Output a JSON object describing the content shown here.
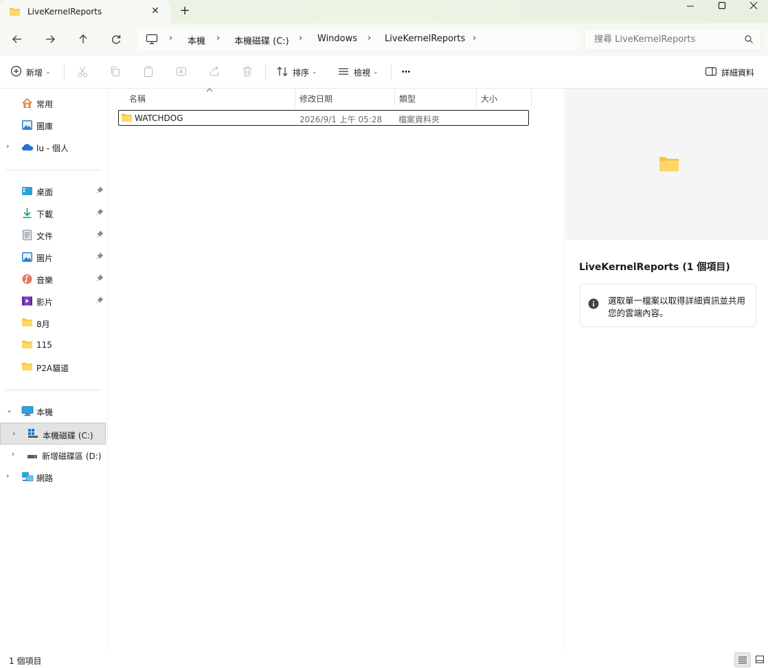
{
  "window": {
    "tab_title": "LiveKernelReports",
    "tab_close": "✕",
    "new_tab": "+"
  },
  "nav": {
    "breadcrumbs": [
      "本機",
      "本機磁碟 (C:)",
      "Windows",
      "LiveKernelReports"
    ],
    "search_placeholder": "搜尋 LiveKernelReports"
  },
  "toolbar": {
    "new_label": "新增",
    "sort_label": "排序",
    "view_label": "檢視",
    "more_label": "···",
    "details_label": "詳細資料"
  },
  "sidebar": {
    "quick": [
      {
        "label": "常用",
        "icon": "home-icon"
      },
      {
        "label": "圖庫",
        "icon": "gallery-icon"
      },
      {
        "label": "lu - 個人",
        "icon": "onedrive-icon"
      }
    ],
    "pinned": [
      {
        "label": "桌面",
        "icon": "desktop-icon"
      },
      {
        "label": "下載",
        "icon": "download-icon"
      },
      {
        "label": "文件",
        "icon": "document-icon"
      },
      {
        "label": "圖片",
        "icon": "pictures-icon"
      },
      {
        "label": "音樂",
        "icon": "music-icon"
      },
      {
        "label": "影片",
        "icon": "video-icon"
      }
    ],
    "folders": [
      {
        "label": "8月"
      },
      {
        "label": "115"
      },
      {
        "label": "P2A貓道"
      }
    ],
    "this_pc": "本機",
    "drives": [
      {
        "label": "本機磁碟 (C:)"
      },
      {
        "label": "新增磁碟區 (D:)"
      }
    ],
    "network": "網路"
  },
  "filelist": {
    "columns": [
      "名稱",
      "修改日期",
      "類型",
      "大小"
    ],
    "rows": [
      {
        "name": "WATCHDOG",
        "modified": "2026/9/1 上午 05:28",
        "type": "檔案資料夾",
        "size": ""
      }
    ]
  },
  "details": {
    "title": "LiveKernelReports (1 個項目)",
    "info": "選取單一檔案以取得詳細資訊並共用您的雲端內容。"
  },
  "status": {
    "item_count": "1 個項目"
  },
  "colors": {
    "folder": "#f5c342",
    "titlebar": "#eaf1e3",
    "selection_border": "#1a1a1a",
    "accent": "#0067c0"
  }
}
